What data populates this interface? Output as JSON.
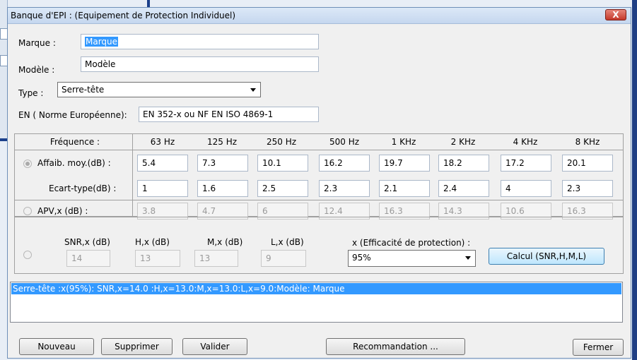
{
  "window": {
    "title": "Banque d'EPI : (Equipement de Protection Individuel)",
    "close_label": "X"
  },
  "form": {
    "marque_label": "Marque :",
    "marque_value": "Marque",
    "modele_label": "Modèle :",
    "modele_value": "Modèle",
    "type_label": "Type :",
    "type_value": "Serre-tête",
    "en_label": "EN ( Norme Européenne):",
    "en_value": "EN 352-x ou NF EN ISO 4869-1"
  },
  "freq": {
    "header_label": "Fréquence :",
    "columns": [
      "63 Hz",
      "125 Hz",
      "250 Hz",
      "500 Hz",
      "1 KHz",
      "2 KHz",
      "4 KHz",
      "8 KHz"
    ],
    "affaib_label": "Affaib. moy.(dB) :",
    "affaib_values": [
      "5.4",
      "7.3",
      "10.1",
      "16.2",
      "19.7",
      "18.2",
      "17.2",
      "20.1"
    ],
    "ecart_label": "Ecart-type(dB) :",
    "ecart_values": [
      "1",
      "1.6",
      "2.5",
      "2.3",
      "2.1",
      "2.4",
      "4",
      "2.3"
    ],
    "apv_label": "APV,x (dB) :",
    "apv_values": [
      "3.8",
      "4.7",
      "6",
      "12.4",
      "16.3",
      "14.3",
      "10.6",
      "16.3"
    ]
  },
  "snr": {
    "snr_label": "SNR,x (dB)",
    "snr_value": "14",
    "h_label": "H,x (dB)",
    "h_value": "13",
    "m_label": "M,x (dB)",
    "m_value": "13",
    "l_label": "L,x (dB)",
    "l_value": "9",
    "eff_label": "x (Efficacité de protection) :",
    "eff_value": "95%",
    "calc_button": "Calcul (SNR,H,M,L)"
  },
  "results": {
    "items": [
      "Serre-tête :x(95%): SNR,x=14.0 :H,x=13.0:M,x=13.0:L,x=9.0:Modèle: Marque"
    ]
  },
  "buttons": {
    "nouveau": "Nouveau",
    "supprimer": "Supprimer",
    "valider": "Valider",
    "recommandation": "Recommandation ...",
    "fermer": "Fermer"
  }
}
